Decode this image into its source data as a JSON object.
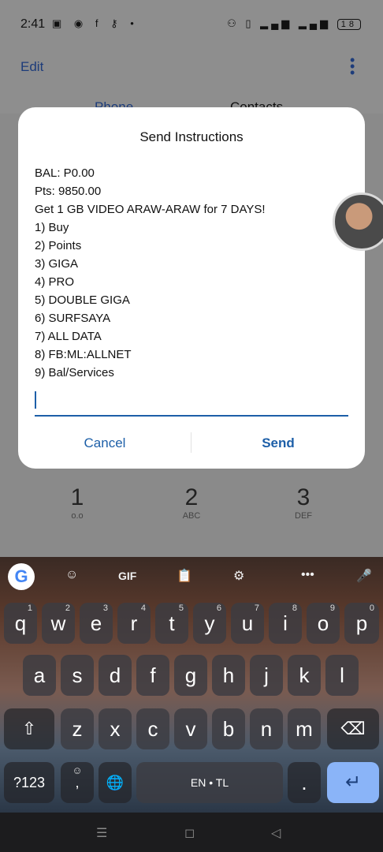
{
  "status_bar": {
    "time": "2:41",
    "left_icons": "▣ ◉ f ⚷ •",
    "right_icons": "⚇ ▯ ▂▄▆ ▂▄▆",
    "battery": "18"
  },
  "dialer": {
    "edit_label": "Edit",
    "tabs": [
      {
        "label": "Phone"
      },
      {
        "label": "Contacts"
      }
    ],
    "keys": [
      {
        "digit": "1",
        "letters": "o.o"
      },
      {
        "digit": "2",
        "letters": "ABC"
      },
      {
        "digit": "3",
        "letters": "DEF"
      }
    ]
  },
  "dialog": {
    "title": "Send Instructions",
    "lines": [
      "BAL: P0.00",
      "Pts: 9850.00",
      "Get 1 GB VIDEO ARAW-ARAW for 7 DAYS!",
      "1) Buy",
      "2) Points",
      "3) GIGA",
      "4) PRO",
      "5) DOUBLE GIGA",
      "6) SURFSAYA",
      "7) ALL DATA",
      "8) FB:ML:ALLNET",
      "9) Bal/Services"
    ],
    "input_value": "",
    "cancel_label": "Cancel",
    "send_label": "Send"
  },
  "keyboard": {
    "toolbar": {
      "g": "G",
      "sticker": "☺",
      "gif": "GIF",
      "clipboard": "📋",
      "settings": "⚙",
      "more": "•••",
      "mic": "🎤"
    },
    "row1": [
      {
        "k": "q",
        "n": "1"
      },
      {
        "k": "w",
        "n": "2"
      },
      {
        "k": "e",
        "n": "3"
      },
      {
        "k": "r",
        "n": "4"
      },
      {
        "k": "t",
        "n": "5"
      },
      {
        "k": "y",
        "n": "6"
      },
      {
        "k": "u",
        "n": "7"
      },
      {
        "k": "i",
        "n": "8"
      },
      {
        "k": "o",
        "n": "9"
      },
      {
        "k": "p",
        "n": "0"
      }
    ],
    "row2": [
      "a",
      "s",
      "d",
      "f",
      "g",
      "h",
      "j",
      "k",
      "l"
    ],
    "row3": [
      "z",
      "x",
      "c",
      "v",
      "b",
      "n",
      "m"
    ],
    "shift": "⇧",
    "backspace": "⌫",
    "symbols": "?123",
    "comma": ",",
    "emoji": "☺",
    "globe": "🌐",
    "space_label": "EN • TL",
    "period": ".",
    "enter": "↵"
  },
  "nav": {
    "recents": "☰",
    "home": "◻",
    "back": "◁"
  }
}
